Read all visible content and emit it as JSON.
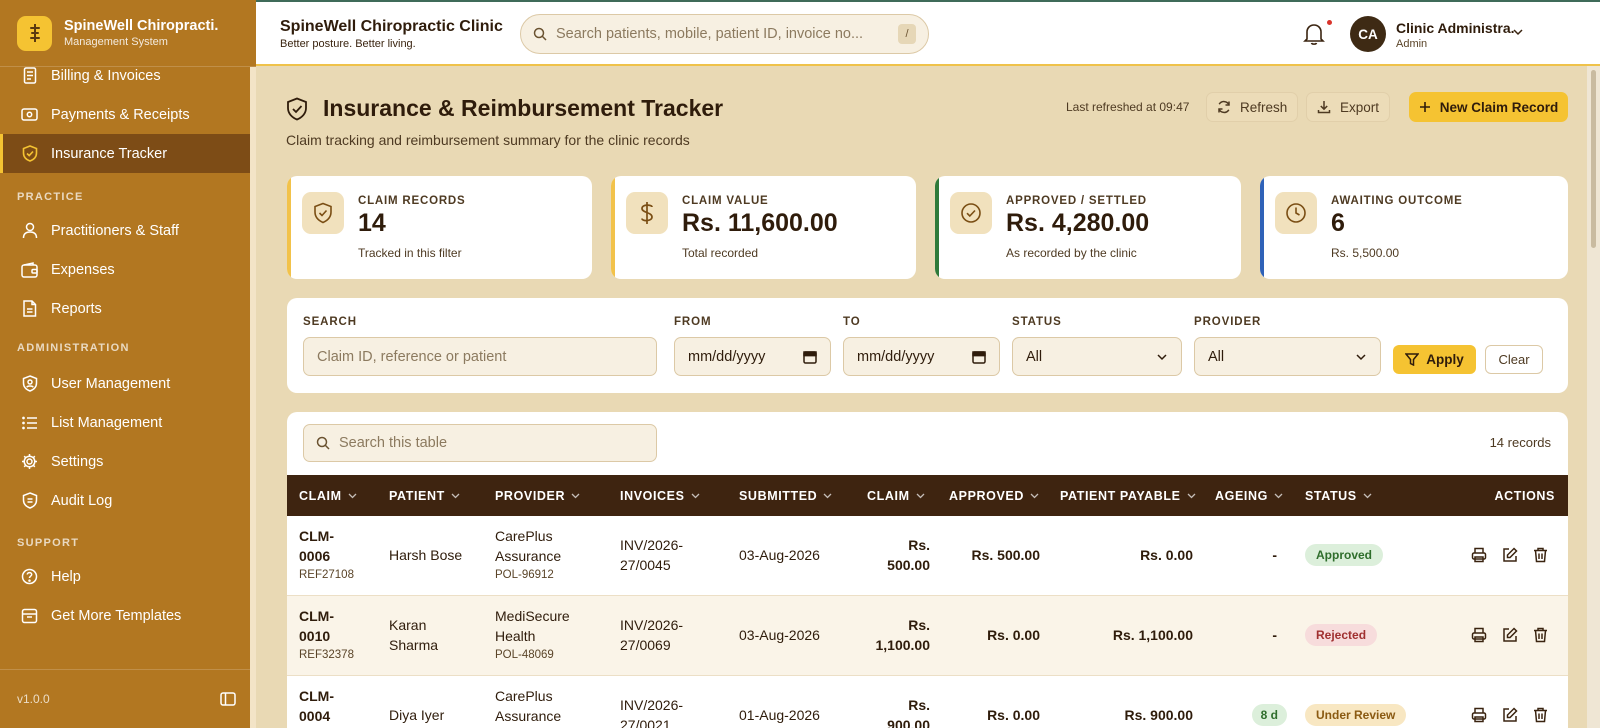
{
  "brand": {
    "name": "SpineWell Chiropracti.",
    "subtitle": "Management System"
  },
  "sidebar": {
    "items_top": [
      {
        "label": "Billing & Invoices",
        "icon": "invoice-icon"
      },
      {
        "label": "Payments & Receipts",
        "icon": "cash-icon"
      },
      {
        "label": "Insurance Tracker",
        "icon": "shield-icon",
        "active": true
      }
    ],
    "sections": [
      {
        "title": "PRACTICE",
        "items": [
          {
            "label": "Practitioners & Staff",
            "icon": "user-icon"
          },
          {
            "label": "Expenses",
            "icon": "wallet-icon"
          },
          {
            "label": "Reports",
            "icon": "report-icon"
          }
        ]
      },
      {
        "title": "ADMINISTRATION",
        "items": [
          {
            "label": "User Management",
            "icon": "shield-user-icon"
          },
          {
            "label": "List Management",
            "icon": "list-icon"
          },
          {
            "label": "Settings",
            "icon": "gear-icon"
          },
          {
            "label": "Audit Log",
            "icon": "shield-icon"
          }
        ]
      },
      {
        "title": "SUPPORT",
        "items": [
          {
            "label": "Help",
            "icon": "help-icon"
          },
          {
            "label": "Get More Templates",
            "icon": "store-icon"
          }
        ]
      }
    ],
    "version": "v1.0.0"
  },
  "header": {
    "clinic_name": "SpineWell Chiropractic Clinic",
    "tagline": "Better posture. Better living.",
    "search_placeholder": "Search patients, mobile, patient ID, invoice no...",
    "search_shortcut": "/",
    "user_initials": "CA",
    "user_name": "Clinic Administra.",
    "user_role": "Admin"
  },
  "page": {
    "title": "Insurance & Reimbursement Tracker",
    "subtitle": "Claim tracking and reimbursement summary for the clinic records",
    "last_refreshed": "Last refreshed at 09:47",
    "refresh_label": "Refresh",
    "export_label": "Export",
    "new_claim_label": "New Claim Record"
  },
  "kpis": [
    {
      "label": "CLAIM RECORDS",
      "value": "14",
      "note": "Tracked in this filter",
      "accent": "#f2c24a",
      "icon": "shield-icon"
    },
    {
      "label": "CLAIM VALUE",
      "value": "Rs. 11,600.00",
      "note": "Total recorded",
      "accent": "#f2c24a",
      "icon": "dollar-icon"
    },
    {
      "label": "APPROVED / SETTLED",
      "value": "Rs. 4,280.00",
      "note": "As recorded by the clinic",
      "accent": "#2f7a3a",
      "icon": "check-circle-icon"
    },
    {
      "label": "AWAITING OUTCOME",
      "value": "6",
      "note": "Rs. 5,500.00",
      "accent": "#2f62b8",
      "icon": "clock-icon"
    }
  ],
  "filters": {
    "search_label": "SEARCH",
    "search_placeholder": "Claim ID, reference or patient",
    "from_label": "FROM",
    "from_value": "mm/dd/yyyy",
    "to_label": "TO",
    "to_value": "mm/dd/yyyy",
    "status_label": "STATUS",
    "status_value": "All",
    "provider_label": "PROVIDER",
    "provider_value": "All",
    "apply_label": "Apply",
    "clear_label": "Clear"
  },
  "table": {
    "search_placeholder": "Search this table",
    "record_count": "14 records",
    "columns": [
      "CLAIM",
      "PATIENT",
      "PROVIDER",
      "INVOICES",
      "SUBMITTED",
      "CLAIM",
      "APPROVED",
      "PATIENT PAYABLE",
      "AGEING",
      "STATUS",
      "ACTIONS"
    ],
    "rows": [
      {
        "claim_id_1": "CLM-",
        "claim_id_2": "0006",
        "ref": "REF27108",
        "patient_1": "Harsh Bose",
        "patient_2": "",
        "provider_1": "CarePlus",
        "provider_2": "Assurance",
        "policy": "POL-96912",
        "invoice_1": "INV/2026-",
        "invoice_2": "27/0045",
        "submitted": "03-Aug-2026",
        "claim_1": "Rs.",
        "claim_2": "500.00",
        "approved": "Rs. 500.00",
        "payable": "Rs. 0.00",
        "ageing": "-",
        "status": "Approved"
      },
      {
        "claim_id_1": "CLM-",
        "claim_id_2": "0010",
        "ref": "REF32378",
        "patient_1": "Karan",
        "patient_2": "Sharma",
        "provider_1": "MediSecure",
        "provider_2": "Health",
        "policy": "POL-48069",
        "invoice_1": "INV/2026-",
        "invoice_2": "27/0069",
        "submitted": "03-Aug-2026",
        "claim_1": "Rs.",
        "claim_2": "1,100.00",
        "approved": "Rs. 0.00",
        "payable": "Rs. 1,100.00",
        "ageing": "-",
        "status": "Rejected"
      },
      {
        "claim_id_1": "CLM-",
        "claim_id_2": "0004",
        "ref": "",
        "patient_1": "Diya Iyer",
        "patient_2": "",
        "provider_1": "CarePlus",
        "provider_2": "Assurance",
        "policy": "",
        "invoice_1": "INV/2026-",
        "invoice_2": "27/0021",
        "submitted": "01-Aug-2026",
        "claim_1": "Rs.",
        "claim_2": "900.00",
        "approved": "Rs. 0.00",
        "payable": "Rs. 900.00",
        "ageing": "8 d",
        "status": "Under Review"
      }
    ]
  }
}
